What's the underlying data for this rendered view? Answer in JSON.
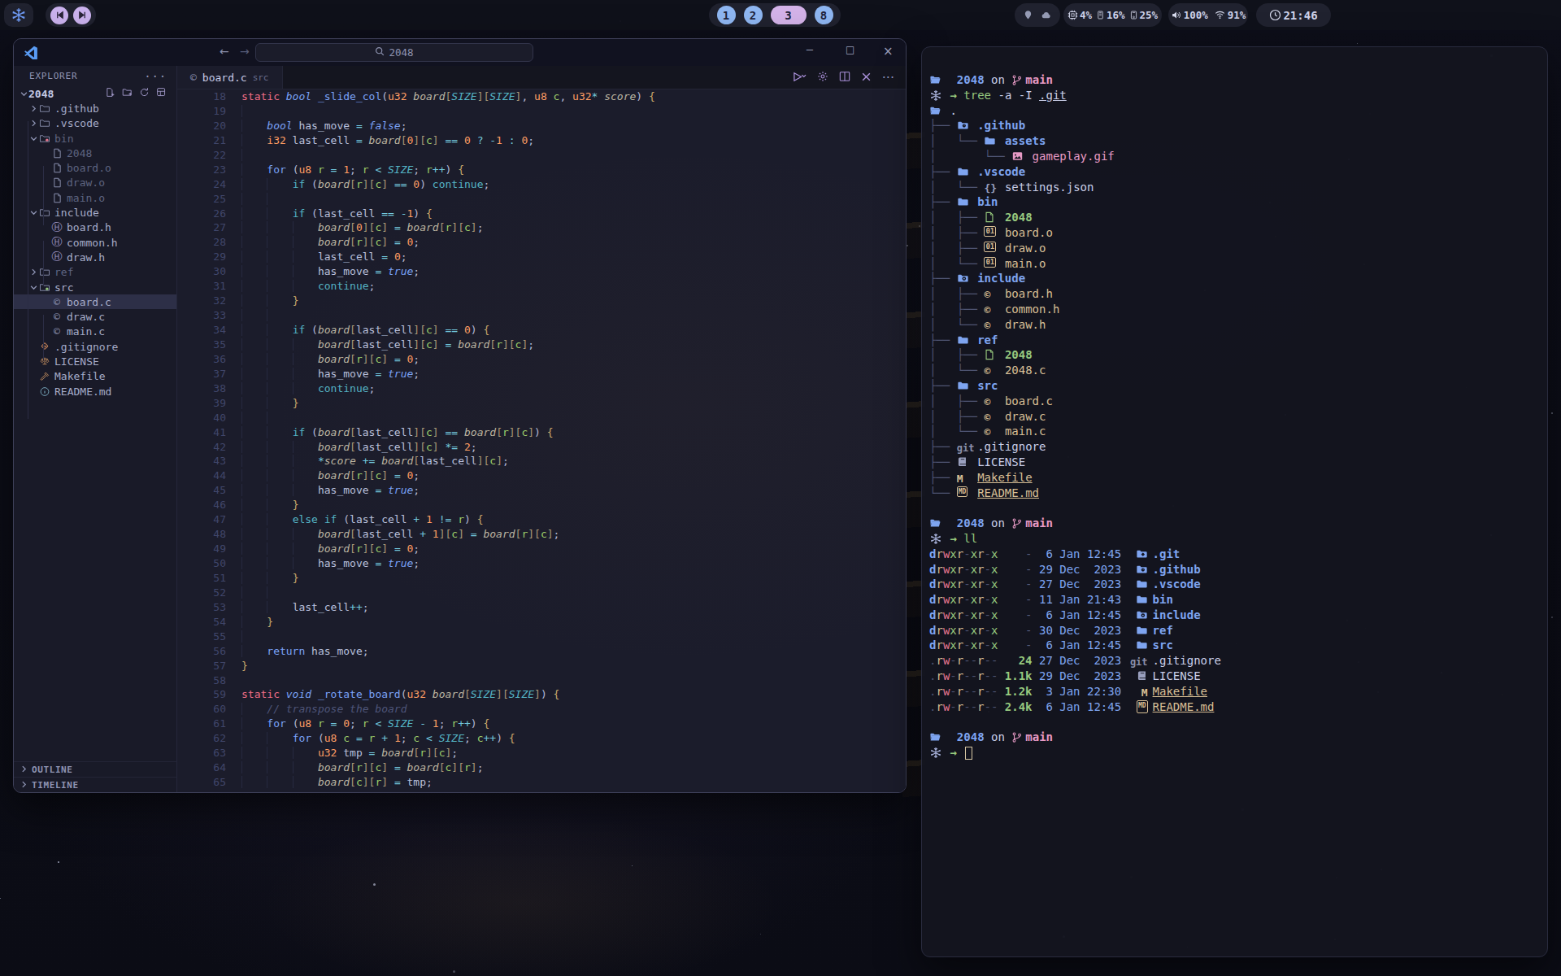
{
  "topbar": {
    "logo_icon": "snowflake-logo",
    "media": {
      "prev": "skip-back-icon",
      "next": "skip-forward-icon"
    },
    "workspaces": {
      "items": [
        "1",
        "2",
        "3",
        "8"
      ],
      "active": "3"
    },
    "weather_icons": [
      "location-pin-icon",
      "cloud-icon"
    ],
    "stats": {
      "cpu": "4%",
      "mem": "16%",
      "disk": "25%"
    },
    "audio": {
      "volume": "100%",
      "wifi": "91%"
    },
    "clock": "21:46"
  },
  "vscode": {
    "search_value": "2048",
    "explorer_title": "EXPLORER",
    "project": "2048",
    "tree": [
      {
        "label": ".github",
        "lvl": 1,
        "type": "dir",
        "exp": false,
        "icon": "folder",
        "dim": false,
        "sel": false
      },
      {
        "label": ".vscode",
        "lvl": 1,
        "type": "dir",
        "exp": false,
        "icon": "folder",
        "dim": false,
        "sel": false
      },
      {
        "label": "bin",
        "lvl": 1,
        "type": "dir",
        "exp": true,
        "icon": "folder-x",
        "dim": true,
        "sel": false
      },
      {
        "label": "2048",
        "lvl": 2,
        "type": "file",
        "icon": "file",
        "dim": true,
        "sel": false
      },
      {
        "label": "board.o",
        "lvl": 2,
        "type": "file",
        "icon": "file",
        "dim": true,
        "sel": false
      },
      {
        "label": "draw.o",
        "lvl": 2,
        "type": "file",
        "icon": "file",
        "dim": true,
        "sel": false
      },
      {
        "label": "main.o",
        "lvl": 2,
        "type": "file",
        "icon": "file",
        "dim": true,
        "sel": false
      },
      {
        "label": "include",
        "lvl": 1,
        "type": "dir",
        "exp": true,
        "icon": "folder",
        "dim": false,
        "sel": false
      },
      {
        "label": "board.h",
        "lvl": 2,
        "type": "file",
        "icon": "h",
        "dim": false,
        "sel": false
      },
      {
        "label": "common.h",
        "lvl": 2,
        "type": "file",
        "icon": "h",
        "dim": false,
        "sel": false
      },
      {
        "label": "draw.h",
        "lvl": 2,
        "type": "file",
        "icon": "h",
        "dim": false,
        "sel": false
      },
      {
        "label": "ref",
        "lvl": 1,
        "type": "dir",
        "exp": false,
        "icon": "folder",
        "dim": true,
        "sel": false
      },
      {
        "label": "src",
        "lvl": 1,
        "type": "dir",
        "exp": true,
        "icon": "folder-src",
        "dim": false,
        "sel": false
      },
      {
        "label": "board.c",
        "lvl": 2,
        "type": "file",
        "icon": "c",
        "dim": false,
        "sel": true
      },
      {
        "label": "draw.c",
        "lvl": 2,
        "type": "file",
        "icon": "c",
        "dim": false,
        "sel": false
      },
      {
        "label": "main.c",
        "lvl": 2,
        "type": "file",
        "icon": "c",
        "dim": false,
        "sel": false
      },
      {
        "label": ".gitignore",
        "lvl": 1,
        "type": "file",
        "icon": "git-diamond",
        "dim": false,
        "sel": false
      },
      {
        "label": "LICENSE",
        "lvl": 1,
        "type": "file",
        "icon": "scales",
        "dim": false,
        "sel": false
      },
      {
        "label": "Makefile",
        "lvl": 1,
        "type": "file",
        "icon": "hammer",
        "dim": false,
        "sel": false
      },
      {
        "label": "README.md",
        "lvl": 1,
        "type": "file",
        "icon": "info",
        "dim": false,
        "sel": false
      }
    ],
    "panels": [
      "OUTLINE",
      "TIMELINE"
    ],
    "tab": {
      "icon": "c-file-icon",
      "icon_glyph": "©",
      "name": "board.c",
      "path": "src"
    },
    "code": [
      {
        "n": 18,
        "t": "static bool _slide_col(u32 board[SIZE][SIZE], u8 c, u32* score) {"
      },
      {
        "n": 19,
        "t": "",
        "g": 1
      },
      {
        "n": 20,
        "t": "    bool has_move = false;"
      },
      {
        "n": 21,
        "t": "    i32 last_cell = board[0][c] == 0 ? -1 : 0;"
      },
      {
        "n": 22,
        "t": "",
        "g": 1
      },
      {
        "n": 23,
        "t": "    for (u8 r = 1; r < SIZE; r++) {"
      },
      {
        "n": 24,
        "t": "        if (board[r][c] == 0) continue;"
      },
      {
        "n": 25,
        "t": "",
        "g": 2
      },
      {
        "n": 26,
        "t": "        if (last_cell == -1) {"
      },
      {
        "n": 27,
        "t": "            board[0][c] = board[r][c];"
      },
      {
        "n": 28,
        "t": "            board[r][c] = 0;"
      },
      {
        "n": 29,
        "t": "            last_cell = 0;"
      },
      {
        "n": 30,
        "t": "            has_move = true;"
      },
      {
        "n": 31,
        "t": "            continue;"
      },
      {
        "n": 32,
        "t": "        }"
      },
      {
        "n": 33,
        "t": "",
        "g": 2
      },
      {
        "n": 34,
        "t": "        if (board[last_cell][c] == 0) {"
      },
      {
        "n": 35,
        "t": "            board[last_cell][c] = board[r][c];"
      },
      {
        "n": 36,
        "t": "            board[r][c] = 0;"
      },
      {
        "n": 37,
        "t": "            has_move = true;"
      },
      {
        "n": 38,
        "t": "            continue;"
      },
      {
        "n": 39,
        "t": "        }"
      },
      {
        "n": 40,
        "t": "",
        "g": 2
      },
      {
        "n": 41,
        "t": "        if (board[last_cell][c] == board[r][c]) {"
      },
      {
        "n": 42,
        "t": "            board[last_cell][c] *= 2;"
      },
      {
        "n": 43,
        "t": "            *score += board[last_cell][c];"
      },
      {
        "n": 44,
        "t": "            board[r][c] = 0;"
      },
      {
        "n": 45,
        "t": "            has_move = true;"
      },
      {
        "n": 46,
        "t": "        }"
      },
      {
        "n": 47,
        "t": "        else if (last_cell + 1 != r) {"
      },
      {
        "n": 48,
        "t": "            board[last_cell + 1][c] = board[r][c];"
      },
      {
        "n": 49,
        "t": "            board[r][c] = 0;"
      },
      {
        "n": 50,
        "t": "            has_move = true;"
      },
      {
        "n": 51,
        "t": "        }"
      },
      {
        "n": 52,
        "t": "",
        "g": 2
      },
      {
        "n": 53,
        "t": "        last_cell++;"
      },
      {
        "n": 54,
        "t": "    }"
      },
      {
        "n": 55,
        "t": "",
        "g": 1
      },
      {
        "n": 56,
        "t": "    return has_move;"
      },
      {
        "n": 57,
        "t": "}"
      },
      {
        "n": 58,
        "t": ""
      },
      {
        "n": 59,
        "t": "static void _rotate_board(u32 board[SIZE][SIZE]) {"
      },
      {
        "n": 60,
        "t": "    // transpose the board"
      },
      {
        "n": 61,
        "t": "    for (u8 r = 0; r < SIZE - 1; r++) {"
      },
      {
        "n": 62,
        "t": "        for (u8 c = r + 1; c < SIZE; c++) {"
      },
      {
        "n": 63,
        "t": "            u32 tmp = board[r][c];"
      },
      {
        "n": 64,
        "t": "            board[r][c] = board[c][r];"
      },
      {
        "n": 65,
        "t": "            board[c][r] = tmp;"
      }
    ]
  },
  "terminal": {
    "prompt": {
      "dir": "2048",
      "on": "on",
      "branch": "main"
    },
    "cmd_tree": {
      "cmd": "tree",
      "args": " -a -I ",
      "pattern": ".git"
    },
    "cmd_ll": "ll",
    "tree": [
      {
        "pre": "",
        "icon": "folder-open",
        "cls": "fg",
        "name": "."
      },
      {
        "pre": "├── ",
        "icon": "folder-gh",
        "cls": "dir",
        "name": ".github"
      },
      {
        "pre": "│   └── ",
        "icon": "folder",
        "cls": "dir",
        "name": "assets"
      },
      {
        "pre": "│       └── ",
        "icon": "image",
        "cls": "pink",
        "name": "gameplay.gif"
      },
      {
        "pre": "├── ",
        "icon": "folder",
        "cls": "dir",
        "name": ".vscode"
      },
      {
        "pre": "│   └── ",
        "icon": "braces",
        "cls": "fg",
        "name": "settings.json"
      },
      {
        "pre": "├── ",
        "icon": "folder",
        "cls": "dir",
        "name": "bin"
      },
      {
        "pre": "│   ├── ",
        "icon": "file",
        "cls": "greenb",
        "name": "2048"
      },
      {
        "pre": "│   ├── ",
        "icon": "binary",
        "cls": "tan",
        "name": "board.o"
      },
      {
        "pre": "│   ├── ",
        "icon": "binary",
        "cls": "tan",
        "name": "draw.o"
      },
      {
        "pre": "│   └── ",
        "icon": "binary",
        "cls": "tan",
        "name": "main.o"
      },
      {
        "pre": "├── ",
        "icon": "folder-gear",
        "cls": "dir",
        "name": "include"
      },
      {
        "pre": "│   ├── ",
        "icon": "c",
        "cls": "tan",
        "name": "board.h"
      },
      {
        "pre": "│   ├── ",
        "icon": "c",
        "cls": "tan",
        "name": "common.h"
      },
      {
        "pre": "│   └── ",
        "icon": "c",
        "cls": "tan",
        "name": "draw.h"
      },
      {
        "pre": "├── ",
        "icon": "folder",
        "cls": "dir",
        "name": "ref"
      },
      {
        "pre": "│   ├── ",
        "icon": "file",
        "cls": "greenb",
        "name": "2048"
      },
      {
        "pre": "│   └── ",
        "icon": "c",
        "cls": "tan",
        "name": "2048.c"
      },
      {
        "pre": "├── ",
        "icon": "folder",
        "cls": "dir",
        "name": "src"
      },
      {
        "pre": "│   ├── ",
        "icon": "c",
        "cls": "tan",
        "name": "board.c"
      },
      {
        "pre": "│   ├── ",
        "icon": "c",
        "cls": "tan",
        "name": "draw.c"
      },
      {
        "pre": "│   └── ",
        "icon": "c",
        "cls": "tan",
        "name": "main.c"
      },
      {
        "pre": "├── ",
        "icon": "git",
        "cls": "fg",
        "name": ".gitignore"
      },
      {
        "pre": "├── ",
        "icon": "book",
        "cls": "fg",
        "name": "LICENSE"
      },
      {
        "pre": "├── ",
        "icon": "mfile",
        "cls": "tanu",
        "name": "Makefile"
      },
      {
        "pre": "└── ",
        "icon": "md",
        "cls": "tanu",
        "name": "README.md"
      }
    ],
    "ls": [
      {
        "p": "drwxr-xr-x",
        "s": "-",
        "d": " 6 Jan 12:45",
        "i": "folder-git",
        "n": ".git",
        "c": "dir"
      },
      {
        "p": "drwxr-xr-x",
        "s": "-",
        "d": "29 Dec  2023",
        "i": "folder-gh",
        "n": ".github",
        "c": "dir"
      },
      {
        "p": "drwxr-xr-x",
        "s": "-",
        "d": "27 Dec  2023",
        "i": "folder",
        "n": ".vscode",
        "c": "dir"
      },
      {
        "p": "drwxr-xr-x",
        "s": "-",
        "d": "11 Jan 21:43",
        "i": "folder",
        "n": "bin",
        "c": "dir"
      },
      {
        "p": "drwxr-xr-x",
        "s": "-",
        "d": " 6 Jan 12:45",
        "i": "folder-gear",
        "n": "include",
        "c": "dir"
      },
      {
        "p": "drwxr-xr-x",
        "s": "-",
        "d": "30 Dec  2023",
        "i": "folder",
        "n": "ref",
        "c": "dir"
      },
      {
        "p": "drwxr-xr-x",
        "s": "-",
        "d": " 6 Jan 12:45",
        "i": "folder",
        "n": "src",
        "c": "dir"
      },
      {
        "p": ".rw-r--r--",
        "s": "24",
        "d": "27 Dec  2023",
        "i": "git",
        "n": ".gitignore",
        "c": "fg"
      },
      {
        "p": ".rw-r--r--",
        "s": "1.1k",
        "d": "29 Dec  2023",
        "i": "book",
        "n": "LICENSE",
        "c": "fg"
      },
      {
        "p": ".rw-r--r--",
        "s": "1.2k",
        "d": " 3 Jan 22:30",
        "i": "mfile",
        "n": "Makefile",
        "c": "tanu"
      },
      {
        "p": ".rw-r--r--",
        "s": "2.4k",
        "d": " 6 Jan 12:45",
        "i": "md",
        "n": "README.md",
        "c": "tanu"
      }
    ]
  }
}
